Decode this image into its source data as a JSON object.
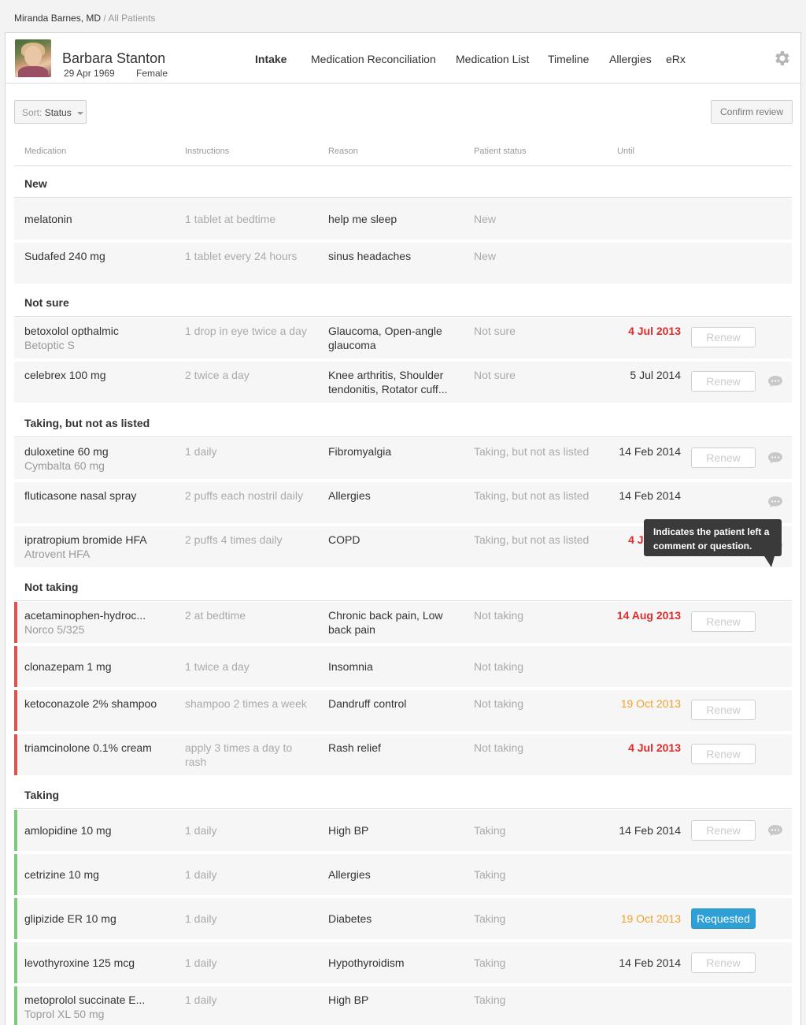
{
  "breadcrumb": {
    "doctor": "Miranda Barnes, MD",
    "separator": "/",
    "current": "All Patients"
  },
  "patient": {
    "name": "Barbara Stanton",
    "dob": "29 Apr 1969",
    "sex": "Female"
  },
  "tabs": [
    "Intake",
    "Medication Reconciliation",
    "Medication List",
    "Timeline",
    "Allergies",
    "eRx"
  ],
  "active_tab": "Intake",
  "toolbar": {
    "sort_label": "Sort:",
    "sort_value": "Status",
    "confirm_label": "Confirm review"
  },
  "columns": [
    "Medication",
    "Instructions",
    "Reason",
    "Patient status",
    "Until"
  ],
  "labels": {
    "renew": "Renew",
    "requested": "Requested"
  },
  "tooltip": "Indicates the patient left a comment or question.",
  "groups": [
    {
      "title": "New",
      "rows": [
        {
          "med": "melatonin",
          "brand": "",
          "ins": "1 tablet at bedtime",
          "reason": "help me sleep",
          "status": "New",
          "until": "",
          "action": "",
          "comment": false
        },
        {
          "med": "Sudafed 240 mg",
          "brand": "",
          "ins": "1 tablet every 24 hours",
          "reason": "sinus headaches",
          "status": "New",
          "until": "",
          "action": "",
          "comment": false
        }
      ]
    },
    {
      "title": "Not sure",
      "rows": [
        {
          "med": "betoxolol opthalmic",
          "brand": "Betoptic S",
          "ins": "1 drop in eye twice a day",
          "reason": "Glaucoma, Open-angle glaucoma",
          "status": "Not sure",
          "until": "4 Jul 2013",
          "action": "renew",
          "comment": false
        },
        {
          "med": "celebrex 100 mg",
          "brand": "",
          "ins": "2 twice a day",
          "reason": "Knee arthritis, Shoulder tendonitis, Rotator cuff...",
          "status": "Not sure",
          "until": "5 Jul 2014",
          "action": "renew",
          "comment": true
        }
      ]
    },
    {
      "title": "Taking, but not as listed",
      "rows": [
        {
          "med": "duloxetine 60 mg",
          "brand": "Cymbalta 60 mg",
          "ins": "1 daily",
          "reason": "Fibromyalgia",
          "status": "Taking, but not as listed",
          "until": "14 Feb 2014",
          "action": "renew",
          "comment": true
        },
        {
          "med": "fluticasone nasal spray",
          "brand": "",
          "ins": "2 puffs each nostril daily",
          "reason": "Allergies",
          "status": "Taking, but not as listed",
          "until": "14 Feb 2014",
          "action": "",
          "comment": true
        },
        {
          "med": "ipratropium bromide HFA",
          "brand": "Atrovent HFA",
          "ins": "2 puffs 4 times daily",
          "reason": "COPD",
          "status": "Taking, but not as listed",
          "until": "4 Jul 2013",
          "action": "requested",
          "comment": true
        }
      ]
    },
    {
      "title": "Not taking",
      "rows": [
        {
          "med": "acetaminophen-hydroc...",
          "brand": "Norco 5/325",
          "ins": "2 at bedtime",
          "reason": "Chronic back pain, Low back pain",
          "status": "Not taking",
          "until": "14 Aug 2013",
          "action": "renew",
          "comment": false
        },
        {
          "med": "clonazepam 1 mg",
          "brand": "",
          "ins": "1 twice a day",
          "reason": "Insomnia",
          "status": "Not taking",
          "until": "",
          "action": "",
          "comment": false
        },
        {
          "med": "ketoconazole 2% shampoo",
          "brand": "",
          "ins": "shampoo 2 times a week",
          "reason": "Dandruff control",
          "status": "Not taking",
          "until": "19 Oct 2013",
          "action": "renew",
          "comment": false
        },
        {
          "med": "triamcinolone 0.1% cream",
          "brand": "",
          "ins": "apply 3 times a day to rash",
          "reason": "Rash relief",
          "status": "Not taking",
          "until": "4 Jul 2013",
          "action": "renew",
          "comment": false
        }
      ]
    },
    {
      "title": "Taking",
      "rows": [
        {
          "med": "amlopidine 10 mg",
          "brand": "",
          "ins": "1 daily",
          "reason": "High BP",
          "status": "Taking",
          "until": "14 Feb 2014",
          "action": "renew",
          "comment": true
        },
        {
          "med": "cetrizine 10 mg",
          "brand": "",
          "ins": "1 daily",
          "reason": "Allergies",
          "status": "Taking",
          "until": "",
          "action": "",
          "comment": false
        },
        {
          "med": "glipizide ER 10 mg",
          "brand": "",
          "ins": "1 daily",
          "reason": "Diabetes",
          "status": "Taking",
          "until": "19 Oct 2013",
          "action": "requested",
          "comment": false
        },
        {
          "med": "levothyroxine 125 mcg",
          "brand": "",
          "ins": "1 daily",
          "reason": "Hypothyroidism",
          "status": "Taking",
          "until": "14 Feb 2014",
          "action": "renew",
          "comment": false
        },
        {
          "med": "metoprolol succinate E...",
          "brand": "Toprol XL 50 mg",
          "ins": "1 daily",
          "reason": "High BP",
          "status": "Taking",
          "until": "",
          "action": "",
          "comment": false
        }
      ]
    }
  ],
  "colors": {
    "accent": "#2ea0d6",
    "overdue": "#e02b2b",
    "upcoming": "#f0a12c",
    "not_taking_bar": "#d9534f",
    "taking_bar": "#7fc97f"
  }
}
